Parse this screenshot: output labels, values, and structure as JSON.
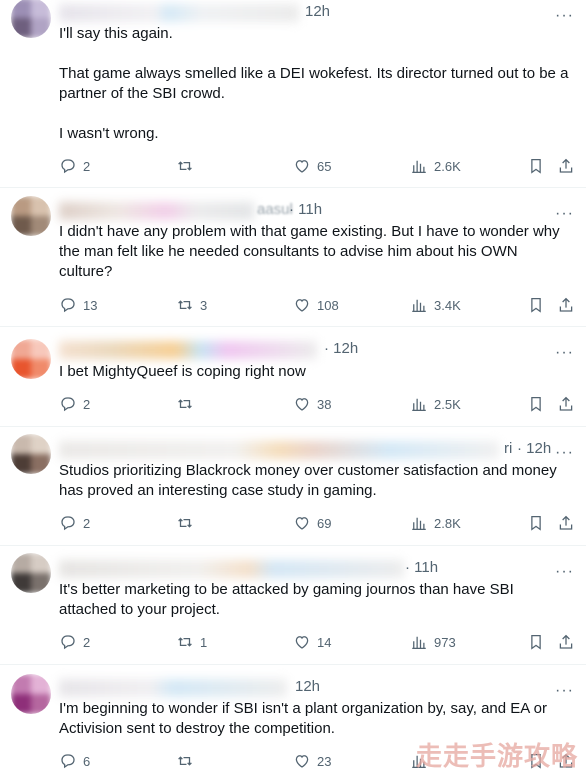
{
  "watermark": "走走手游攻略",
  "icons": {
    "reply": "reply-icon",
    "retweet": "retweet-icon",
    "like": "heart-icon",
    "views": "views-icon",
    "bookmark": "bookmark-icon",
    "share": "share-icon",
    "more": "more-icon"
  },
  "tweets": [
    {
      "handle_visible": "",
      "time": "12h",
      "text": "I'll say this again.\n\nThat game always smelled like a DEI wokefest. Its director turned out to be a partner of the SBI crowd.\n\nI wasn't wrong.",
      "replies": "2",
      "retweets": "",
      "likes": "65",
      "views": "2.6K"
    },
    {
      "handle_visible": "aasul",
      "time": "· 11h",
      "text": "I didn't have any problem with that game existing. But I have to wonder why the man felt like he needed consultants to advise him about his OWN culture?",
      "replies": "13",
      "retweets": "3",
      "likes": "108",
      "views": "3.4K"
    },
    {
      "handle_visible": "",
      "time": "· 12h",
      "text": "I bet MightyQueef is coping right now",
      "replies": "2",
      "retweets": "",
      "likes": "38",
      "views": "2.5K"
    },
    {
      "handle_visible": "ri",
      "time": "· 12h",
      "text": "Studios prioritizing Blackrock money over customer satisfaction and money has proved an interesting case study in gaming.",
      "replies": "2",
      "retweets": "",
      "likes": "69",
      "views": "2.8K"
    },
    {
      "handle_visible": "",
      "time": "· 11h",
      "text": "It's better marketing to be attacked by gaming journos than have SBI attached to your project.",
      "replies": "2",
      "retweets": "1",
      "likes": "14",
      "views": "973"
    },
    {
      "handle_visible": "",
      "time": "12h",
      "text": "I'm beginning to wonder if SBI isn't a plant organization by, say, and EA or Activision sent to destroy the competition.",
      "replies": "6",
      "retweets": "",
      "likes": "23",
      "views": ""
    }
  ]
}
